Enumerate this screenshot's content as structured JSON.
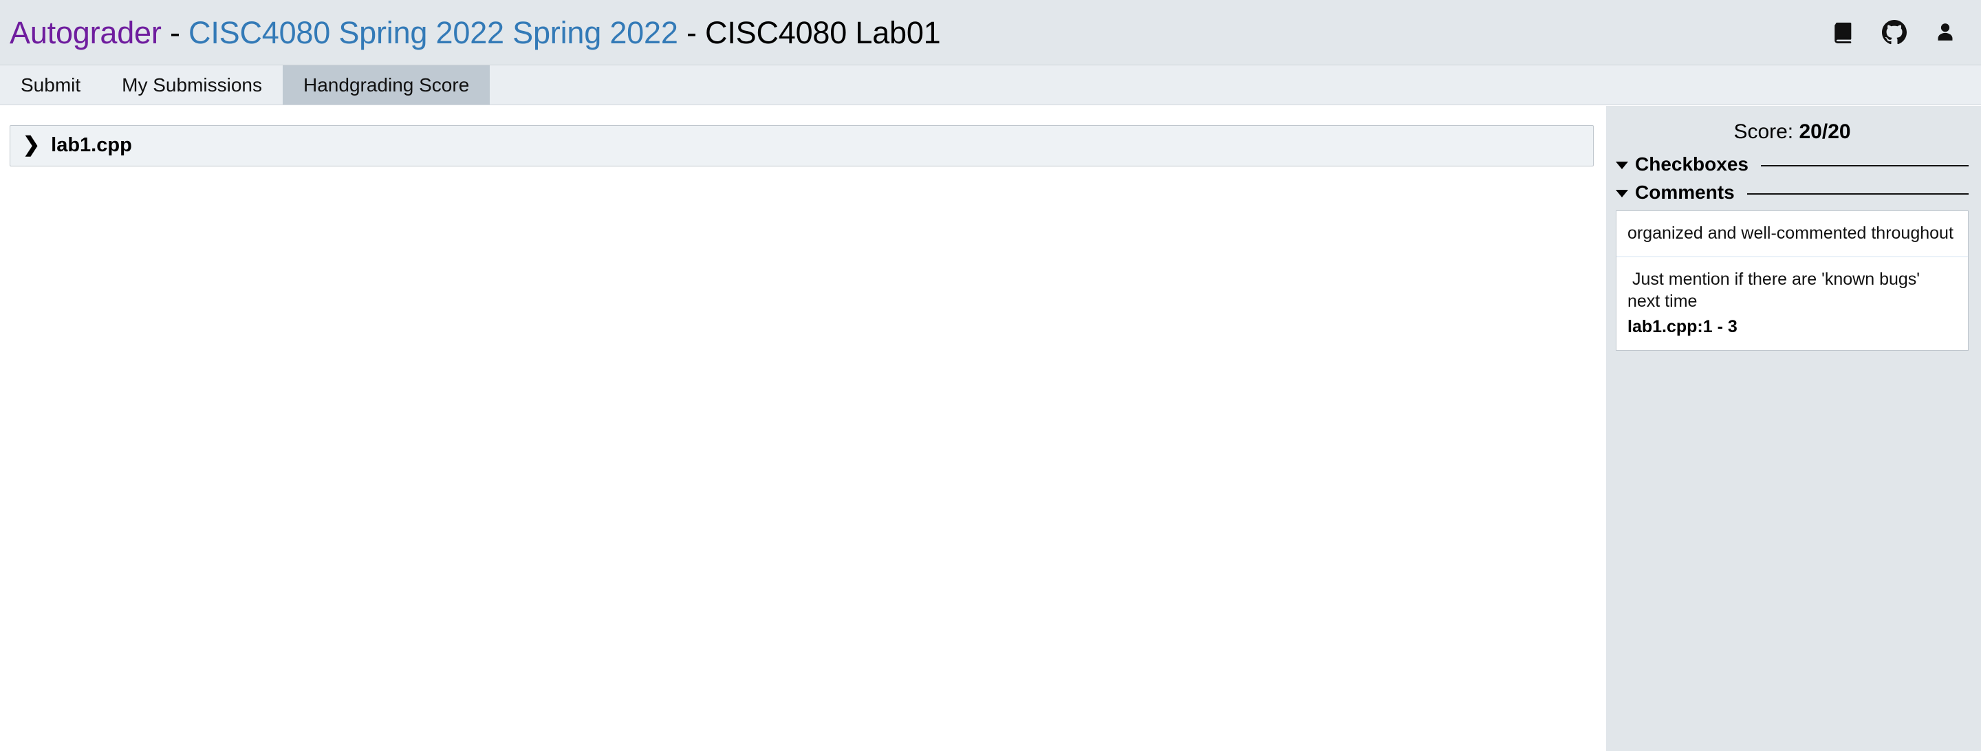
{
  "navbar": {
    "brand": {
      "app_name": "Autograder",
      "separator_1": " - ",
      "course_name": "CISC4080 Spring 2022 Spring 2022",
      "separator_2": " - ",
      "project_name": "CISC4080 Lab01"
    },
    "icons": [
      {
        "name": "book-icon",
        "title": "Documentation"
      },
      {
        "name": "github-icon",
        "title": "GitHub"
      },
      {
        "name": "user-icon",
        "title": "Account"
      }
    ]
  },
  "tabs": [
    {
      "label": "Submit",
      "active": false
    },
    {
      "label": "My Submissions",
      "active": false
    },
    {
      "label": "Handgrading Score",
      "active": true
    }
  ],
  "main": {
    "files": [
      {
        "name": "lab1.cpp",
        "expanded": false
      }
    ]
  },
  "sidebar": {
    "score_label": "Score: ",
    "score_value": "20/20",
    "sections": [
      {
        "title": "Checkboxes",
        "expanded": true
      },
      {
        "title": "Comments",
        "expanded": true
      }
    ],
    "comments": [
      {
        "text": "organized and well-commented throughout",
        "location": ""
      },
      {
        "text": " Just mention if there are 'known bugs' next time",
        "location": "lab1.cpp:1 - 3"
      }
    ]
  },
  "colors": {
    "navbar_bg": "#e2e7eb",
    "tabbar_bg": "#eaeef2",
    "active_tab_bg": "#bfc9d2",
    "sidebar_bg": "#e1e6ea",
    "brand_purple": "#6f1d9e",
    "brand_blue": "#337ab7",
    "file_row_bg": "#eef2f5"
  }
}
